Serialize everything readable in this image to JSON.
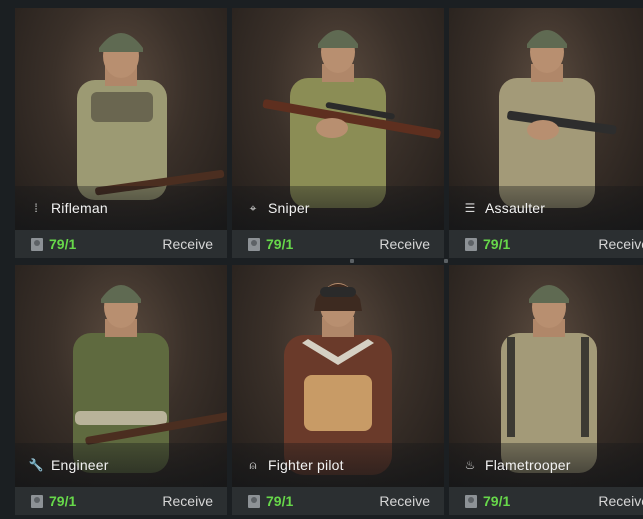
{
  "cards": [
    {
      "name": "Rifleman",
      "icon": "rifle-icon",
      "glyph": "⁞",
      "qty": "79/1",
      "action": "Receive"
    },
    {
      "name": "Sniper",
      "icon": "crosshair-icon",
      "glyph": "⌖",
      "qty": "79/1",
      "action": "Receive"
    },
    {
      "name": "Assaulter",
      "icon": "magazine-icon",
      "glyph": "☰",
      "qty": "79/1",
      "action": "Receive"
    },
    {
      "name": "Engineer",
      "icon": "wrench-icon",
      "glyph": "🔧",
      "qty": "79/1",
      "action": "Receive"
    },
    {
      "name": "Fighter pilot",
      "icon": "pilot-helmet-icon",
      "glyph": "⍝",
      "qty": "79/1",
      "action": "Receive"
    },
    {
      "name": "Flametrooper",
      "icon": "flame-icon",
      "glyph": "♨",
      "qty": "79/1",
      "action": "Receive"
    }
  ],
  "colors": {
    "qty": "#67d84a",
    "background": "#1b1f22",
    "footer": "#2b2f31"
  }
}
